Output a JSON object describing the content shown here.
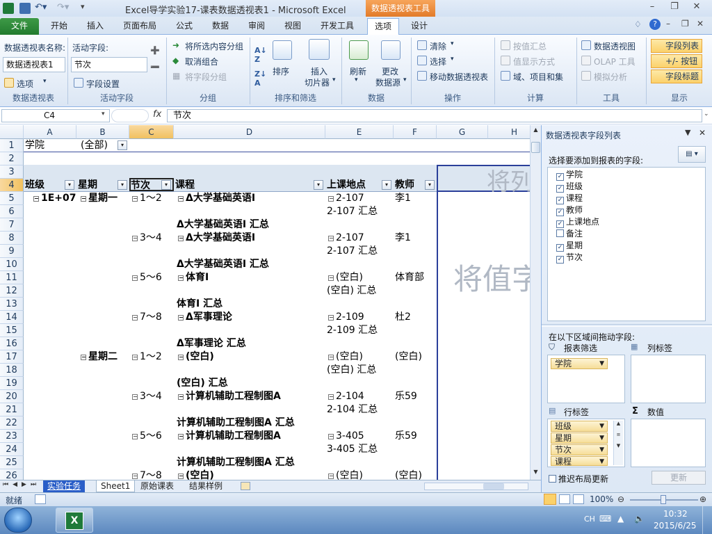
{
  "window": {
    "title": "Excel导学实验17-课表数据透视表1 - Microsoft Excel",
    "context_tab": "数据透视表工具"
  },
  "tabs": [
    "文件",
    "开始",
    "插入",
    "页面布局",
    "公式",
    "数据",
    "审阅",
    "视图",
    "开发工具",
    "选项",
    "设计"
  ],
  "ribbon": {
    "pt_name_label": "数据透视表名称:",
    "pt_name_value": "数据透视表1",
    "options_btn": "选项",
    "group1": "数据透视表",
    "active_field_label": "活动字段:",
    "active_field_value": "节次",
    "field_settings": "字段设置",
    "group2": "活动字段",
    "group_sel": "将所选内容分组",
    "ungroup": "取消组合",
    "group_field": "将字段分组",
    "group3": "分组",
    "sort": "排序",
    "slicer1": "插入",
    "slicer2": "切片器",
    "group4": "排序和筛选",
    "refresh": "刷新",
    "change_src1": "更改",
    "change_src2": "数据源",
    "group5": "数据",
    "clear": "清除",
    "select": "选择",
    "move_pt": "移动数据透视表",
    "group6": "操作",
    "summarize": "按值汇总",
    "show_as": "值显示方式",
    "fields_items": "域、项目和集",
    "group7": "计算",
    "pivotchart": "数据透视图",
    "olap": "OLAP 工具",
    "whatif": "模拟分析",
    "group8": "工具",
    "field_list": "字段列表",
    "plus_minus": "+/- 按钮",
    "field_headers": "字段标题",
    "group9": "显示"
  },
  "formula_bar": {
    "name_box": "C4",
    "fx": "fx",
    "value": "节次"
  },
  "columns": [
    "A",
    "B",
    "C",
    "D",
    "E",
    "F",
    "G",
    "H"
  ],
  "rows": {
    "r1": {
      "a": "学院",
      "b": "(全部)"
    },
    "r3_watermark": "将列",
    "r4": {
      "a": "班级",
      "b": "星期",
      "c": "节次",
      "d": "课程",
      "e": "上课地点",
      "f": "教师"
    },
    "r5": {
      "a": "1E+07",
      "b": "星期一",
      "c": "1～2",
      "d": "Δ大学基础英语Ⅰ",
      "e": "2-107",
      "f": "李1"
    },
    "r6": {
      "e": "2-107 汇总"
    },
    "r7": {
      "d": "Δ大学基础英语Ⅰ 汇总"
    },
    "r8": {
      "c": "3～4",
      "d": "Δ大学基础英语Ⅰ",
      "e": "2-107",
      "f": "李1"
    },
    "r9": {
      "e": "2-107 汇总"
    },
    "r10": {
      "d": "Δ大学基础英语Ⅰ 汇总"
    },
    "r11": {
      "c": "5～6",
      "d": "体育Ⅰ",
      "e": "(空白)",
      "f": "体育部"
    },
    "r12": {
      "e": "(空白) 汇总"
    },
    "r13": {
      "d": "体育Ⅰ 汇总"
    },
    "r14": {
      "c": "7～8",
      "d": "Δ军事理论",
      "e": "2-109",
      "f": "杜2"
    },
    "r15": {
      "e": "2-109 汇总"
    },
    "r16": {
      "d": "Δ军事理论 汇总"
    },
    "r17": {
      "b": "星期二",
      "c": "1～2",
      "d": "(空白)",
      "e": "(空白)",
      "f": "(空白)"
    },
    "r18": {
      "e": "(空白) 汇总"
    },
    "r19": {
      "d": "(空白) 汇总"
    },
    "r20": {
      "c": "3～4",
      "d": "计算机辅助工程制图A",
      "e": "2-104",
      "f": "乐59"
    },
    "r21": {
      "e": "2-104 汇总"
    },
    "r22": {
      "d": "计算机辅助工程制图A 汇总"
    },
    "r23": {
      "c": "5～6",
      "d": "计算机辅助工程制图A",
      "e": "3-405",
      "f": "乐59"
    },
    "r24": {
      "e": "3-405 汇总"
    },
    "r25": {
      "d": "计算机辅助工程制图A 汇总"
    },
    "r26": {
      "c": "7～8",
      "d": "(空白)",
      "e": "(空白)",
      "f": "(空白)"
    },
    "values_watermark": "将值字"
  },
  "sheet_tabs": [
    "实验任务",
    "Sheet1",
    "原始课表",
    "结果样例"
  ],
  "status": {
    "ready": "就绪",
    "zoom": "100%"
  },
  "pane": {
    "title": "数据透视表字段列表",
    "choose_label": "选择要添加到报表的字段:",
    "fields": [
      {
        "name": "学院",
        "checked": true
      },
      {
        "name": "班级",
        "checked": true
      },
      {
        "name": "课程",
        "checked": true
      },
      {
        "name": "教师",
        "checked": true
      },
      {
        "name": "上课地点",
        "checked": true
      },
      {
        "name": "备注",
        "checked": false
      },
      {
        "name": "星期",
        "checked": true
      },
      {
        "name": "节次",
        "checked": true
      }
    ],
    "drag_label": "在以下区域间拖动字段:",
    "report_filter": "报表筛选",
    "column_labels": "列标签",
    "row_labels": "行标签",
    "values": "数值",
    "filter_items": [
      "学院"
    ],
    "row_items": [
      "班级",
      "星期",
      "节次",
      "课程"
    ],
    "defer": "推迟布局更新",
    "update": "更新"
  },
  "taskbar": {
    "lang": "CH",
    "time": "10:32",
    "date": "2015/6/25"
  },
  "colors": {
    "accent_green": "#227b2e",
    "context_orange": "#e27b2a",
    "highlight": "#fbd16b"
  }
}
